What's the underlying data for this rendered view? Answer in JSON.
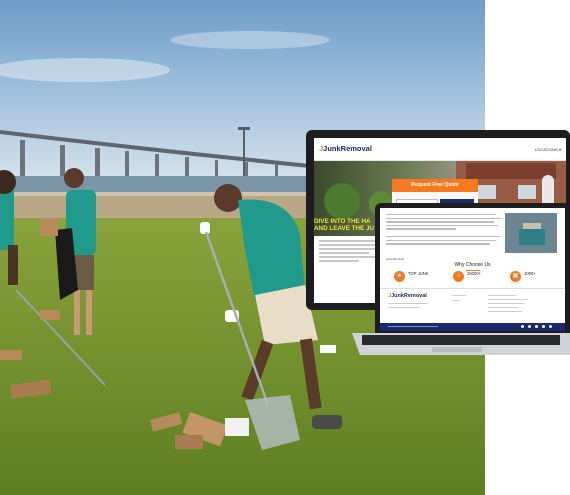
{
  "site": {
    "logo_main": "JunkRemoval",
    "logo_sub": "",
    "locations_label": "LOCATIONS ▾"
  },
  "hero": {
    "cta": "Request Free Quote",
    "headline_line1": "DIVE INTO THE HA",
    "headline_line2": "AND LEAVE THE JU"
  },
  "laptop": {
    "link_text": "Junk Removal",
    "section_title": "Why Choose Us",
    "stats": [
      {
        "value": "TOP JUNK",
        "label": "",
        "icon": "trophy-icon"
      },
      {
        "value": "25000+",
        "label": "",
        "icon": "home-icon"
      },
      {
        "value": "1000+",
        "label": "",
        "icon": "truck-icon"
      }
    ],
    "footer_logo": "JunkRemoval"
  },
  "colors": {
    "accent": "#f47a20",
    "brand_navy": "#1b2a6b",
    "headline_yellow": "#f2e33a"
  }
}
